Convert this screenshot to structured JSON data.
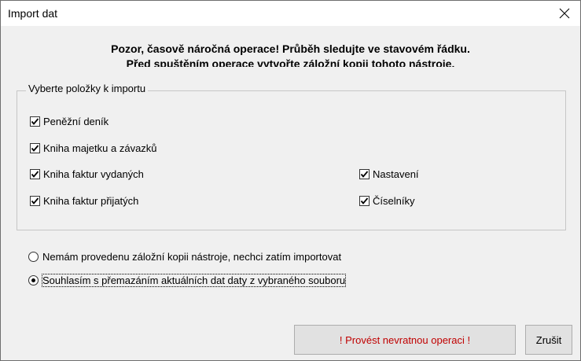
{
  "dialog": {
    "title": "Import dat",
    "close_icon": "close-icon"
  },
  "warning": {
    "line1": "Pozor, časově náročná operace! Průběh sledujte ve stavovém řádku.",
    "line2": "Před spuštěním operace vytvořte záložní kopii tohoto nástroje."
  },
  "import_group": {
    "legend": "Vyberte položky k importu",
    "items": [
      {
        "label": "Peněžní deník",
        "checked": true
      },
      {
        "label": "Kniha majetku a závazků",
        "checked": true
      },
      {
        "label": "Kniha faktur vydaných",
        "checked": true
      },
      {
        "label": "Kniha faktur přijatých",
        "checked": true
      },
      {
        "label": "Nastavení",
        "checked": true
      },
      {
        "label": "Číselníky",
        "checked": true
      }
    ]
  },
  "options": [
    {
      "label": "Nemám provedenu záložní kopii nástroje, nechci zatím importovat",
      "selected": false
    },
    {
      "label": "Souhlasím s přemazáním aktuálních dat daty z vybraného souboru",
      "selected": true
    }
  ],
  "buttons": {
    "execute": "! Provést nevratnou operaci !",
    "cancel": "Zrušit"
  },
  "colors": {
    "danger_text": "#c00000",
    "dialog_bg": "#f0f0f0",
    "title_bg": "#ffffff"
  }
}
